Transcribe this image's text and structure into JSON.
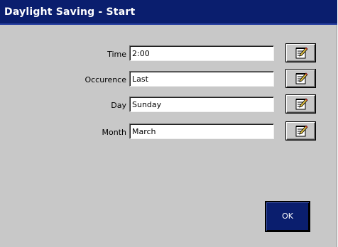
{
  "window": {
    "title": "Daylight Saving - Start"
  },
  "fields": [
    {
      "label": "Time",
      "value": "2:00"
    },
    {
      "label": "Occurence",
      "value": "Last"
    },
    {
      "label": "Day",
      "value": "Sunday"
    },
    {
      "label": "Month",
      "value": "March"
    }
  ],
  "buttons": {
    "ok_label": "OK",
    "edit_icon": "notepad-edit-icon"
  },
  "colors": {
    "titlebar": "#0a1e6e",
    "background": "#c8c8c8",
    "ok_button": "#0a1e6e"
  }
}
